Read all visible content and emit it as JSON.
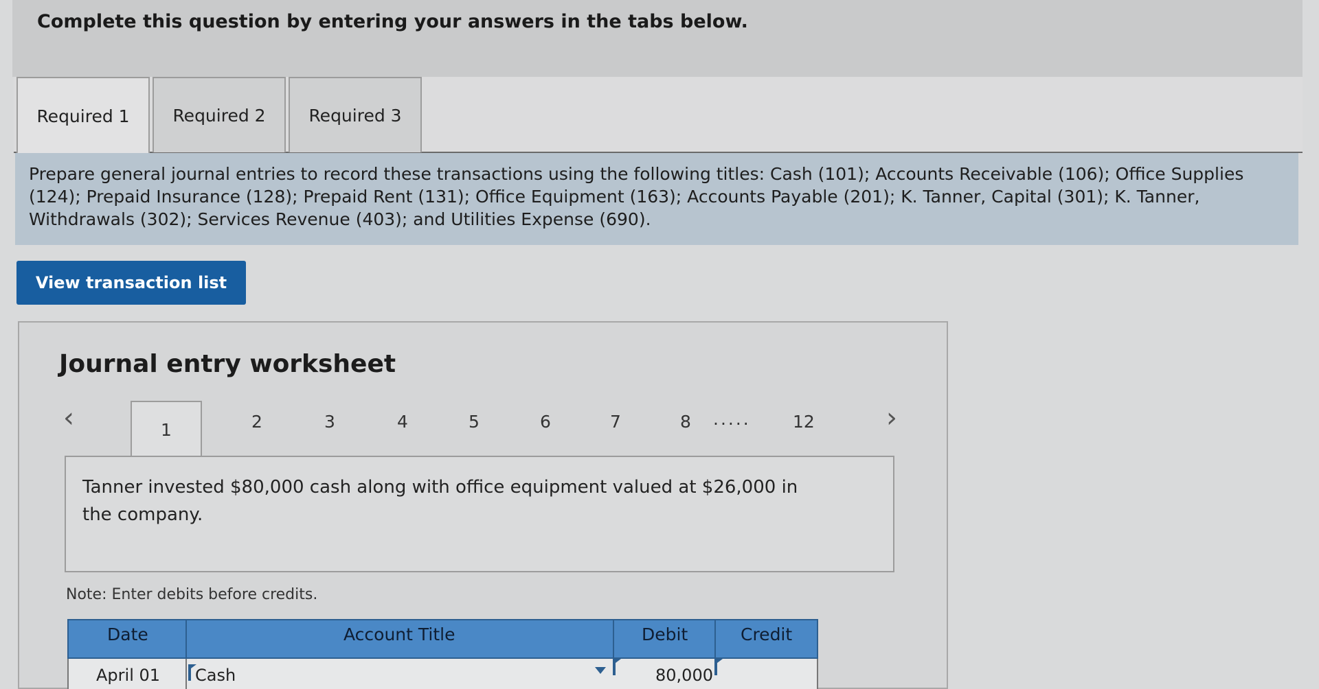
{
  "header": {
    "instruction": "Complete this question by entering your answers in the tabs below."
  },
  "tabs": [
    {
      "label": "Required 1",
      "active": true
    },
    {
      "label": "Required 2",
      "active": false
    },
    {
      "label": "Required 3",
      "active": false
    }
  ],
  "instructions_text": "Prepare general journal entries to record these transactions using the following titles: Cash (101); Accounts Receivable (106); Office Supplies (124); Prepaid Insurance (128); Prepaid Rent (131); Office Equipment (163); Accounts Payable (201); K. Tanner, Capital (301); K. Tanner, Withdrawals (302); Services Revenue (403); and Utilities Expense (690).",
  "view_button_label": "View transaction list",
  "worksheet": {
    "title": "Journal entry worksheet",
    "pages": [
      "1",
      "2",
      "3",
      "4",
      "5",
      "6",
      "7",
      "8",
      "12"
    ],
    "active_page": "1",
    "ellipsis": ".....",
    "prev_icon": "chevron-left-icon",
    "next_icon": "chevron-right-icon",
    "transaction": "Tanner invested $80,000 cash along with office equipment valued at $26,000 in the company.",
    "note": "Note: Enter debits before credits.",
    "table": {
      "headers": [
        "Date",
        "Account Title",
        "Debit",
        "Credit"
      ],
      "rows": [
        {
          "date": "April 01",
          "account": "Cash",
          "debit": "80,000",
          "credit": ""
        }
      ]
    }
  },
  "colors": {
    "accent_button": "#185ea0",
    "table_header": "#4a88c6",
    "instructions_bg": "#b7c4cf"
  }
}
